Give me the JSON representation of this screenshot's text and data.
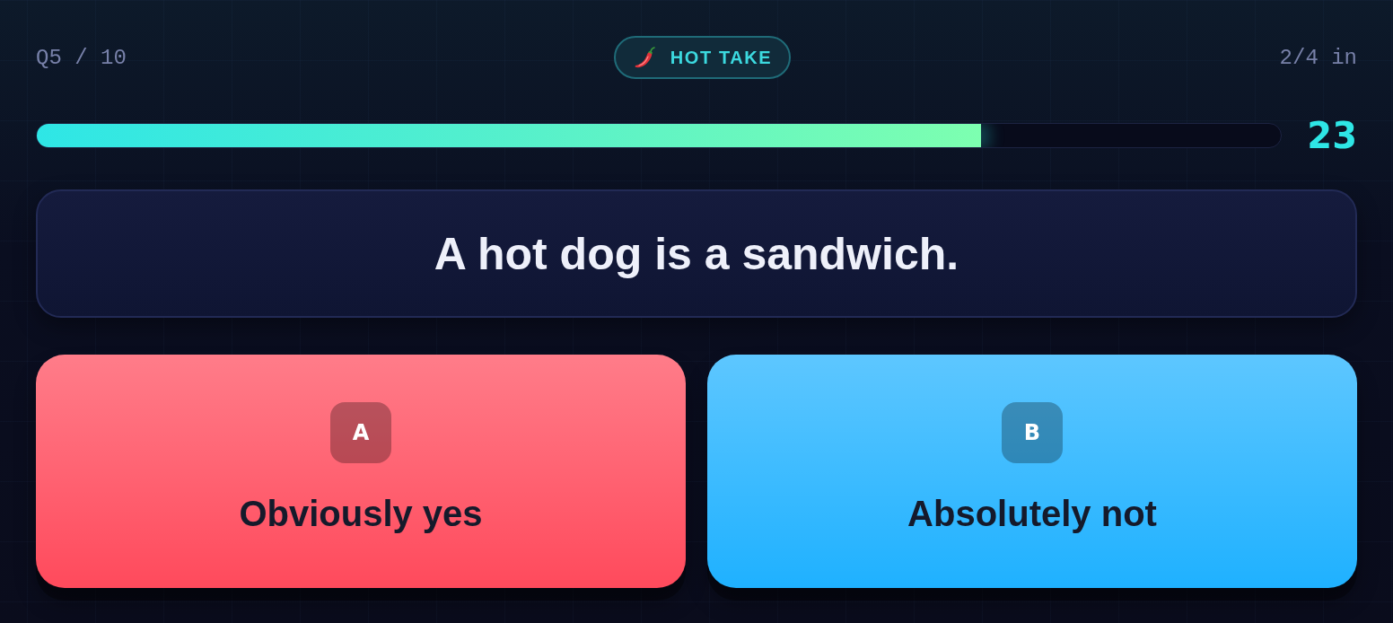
{
  "header": {
    "question_counter": "Q5 / 10",
    "category": "HOT TAKE",
    "answered_count": "2/4 in"
  },
  "timer": {
    "level": 0.76,
    "seconds": "23"
  },
  "question": "A hot dog is a sandwich.",
  "answers": [
    {
      "letter": "A",
      "label": "Obviously yes",
      "color": "#ff4a5c"
    },
    {
      "letter": "B",
      "label": "Absolutely not",
      "color": "#1fb1ff"
    }
  ]
}
